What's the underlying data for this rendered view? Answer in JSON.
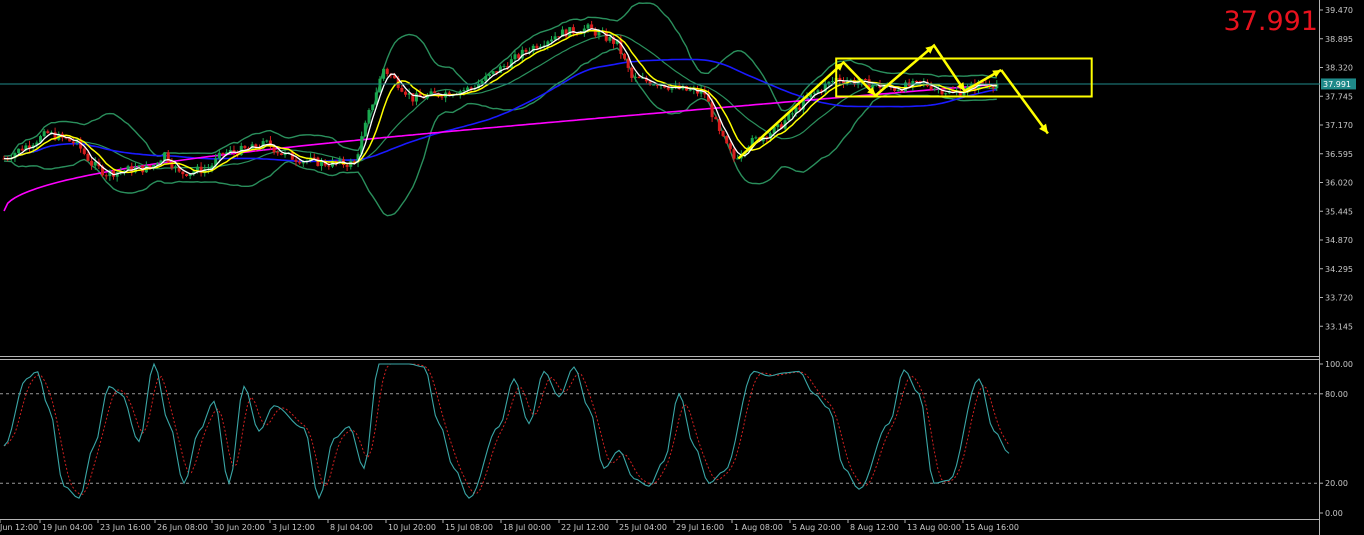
{
  "bid_display": "37.991",
  "current_price_label": "37.991",
  "chart_data": [
    {
      "type": "candlestick",
      "title": "",
      "price_axis_ticks": [
        "39.470",
        "38.895",
        "38.320",
        "37.745",
        "37.170",
        "36.595",
        "36.020",
        "35.445",
        "34.870",
        "34.295",
        "33.720",
        "33.145"
      ],
      "ylim": [
        32.8,
        39.6
      ],
      "time_axis_ticks": [
        "Jun 12:00",
        "19 Jun 04:00",
        "23 Jun 16:00",
        "26 Jun 08:00",
        "30 Jun 20:00",
        "3 Jul 12:00",
        "8 Jul 04:00",
        "10 Jul 20:00",
        "15 Jul 08:00",
        "18 Jul 00:00",
        "22 Jul 12:00",
        "25 Jul 04:00",
        "29 Jul 16:00",
        "1 Aug 08:00",
        "5 Aug 20:00",
        "8 Aug 12:00",
        "13 Aug 00:00",
        "15 Aug 16:00"
      ],
      "current_price": 37.991,
      "grid": false,
      "overlays": [
        {
          "name": "",
          "color": "#ffff00",
          "role": "fast moving average"
        },
        {
          "name": "",
          "color": "#ffffff",
          "role": "fastest moving average"
        },
        {
          "name": "",
          "color": "#2a8f5c",
          "role": "bollinger bands"
        },
        {
          "name": "",
          "color": "#1a1aff",
          "role": "slow moving average"
        },
        {
          "name": "",
          "color": "#ff00ff",
          "role": "slowest moving average"
        }
      ],
      "close_path": [
        [
          0,
          36.5
        ],
        [
          3,
          37.0
        ],
        [
          5,
          36.8
        ],
        [
          6,
          36.4
        ],
        [
          7,
          36.2
        ],
        [
          9,
          36.3
        ],
        [
          10,
          36.3
        ],
        [
          11,
          36.6
        ],
        [
          12,
          36.2
        ],
        [
          14,
          36.3
        ],
        [
          15,
          36.6
        ],
        [
          17,
          36.7
        ],
        [
          18,
          36.8
        ],
        [
          19,
          36.6
        ],
        [
          20,
          36.5
        ],
        [
          22,
          36.4
        ],
        [
          24,
          36.4
        ],
        [
          25,
          37.4
        ],
        [
          26,
          38.3
        ],
        [
          27,
          38.0
        ],
        [
          28,
          37.7
        ],
        [
          30,
          37.8
        ],
        [
          32,
          37.9
        ],
        [
          34,
          38.3
        ],
        [
          36,
          38.7
        ],
        [
          38,
          39.0
        ],
        [
          40,
          39.1
        ],
        [
          42,
          38.8
        ],
        [
          43,
          38.1
        ],
        [
          45,
          38.0
        ],
        [
          46,
          37.9
        ],
        [
          48,
          37.8
        ],
        [
          49,
          37.0
        ],
        [
          50,
          36.5
        ],
        [
          51,
          36.8
        ],
        [
          53,
          37.1
        ],
        [
          55,
          37.7
        ],
        [
          57,
          38.1
        ],
        [
          59,
          38.0
        ],
        [
          61,
          37.9
        ],
        [
          63,
          38.0
        ],
        [
          65,
          37.8
        ],
        [
          66,
          37.9
        ],
        [
          67,
          38.0
        ],
        [
          68,
          37.991
        ]
      ],
      "annotations": [
        {
          "type": "rectangle",
          "color": "#ffff00",
          "from": [
            57,
            37.74
          ],
          "to": [
            74.5,
            38.5
          ]
        },
        {
          "type": "zigzag-arrow",
          "color": "#ffff00",
          "points": [
            [
              50.3,
              36.5
            ],
            [
              57.5,
              38.42
            ],
            [
              59.7,
              37.76
            ],
            [
              63.7,
              38.76
            ],
            [
              65.8,
              37.85
            ],
            [
              68.3,
              38.27
            ]
          ]
        },
        {
          "type": "arrow",
          "color": "#ffff00",
          "from": [
            68.3,
            38.27
          ],
          "to": [
            71.5,
            37.0
          ]
        }
      ]
    },
    {
      "type": "line",
      "title": "",
      "ylim": [
        0,
        100
      ],
      "y_ticks": [
        "100.00",
        "80.00",
        "20.00",
        "0.00"
      ],
      "levels": [
        80,
        20
      ],
      "series": [
        {
          "name": "",
          "color": "#3aa6a6",
          "role": "main",
          "values": [
            [
              0,
              45
            ],
            [
              1.5,
              90
            ],
            [
              2.2,
              95
            ],
            [
              3,
              70
            ],
            [
              4,
              18
            ],
            [
              5,
              10
            ],
            [
              6,
              45
            ],
            [
              7,
              85
            ],
            [
              7.8,
              80
            ],
            [
              9,
              48
            ],
            [
              10,
              100
            ],
            [
              11,
              60
            ],
            [
              12,
              20
            ],
            [
              13,
              55
            ],
            [
              14,
              75
            ],
            [
              15,
              20
            ],
            [
              16,
              85
            ],
            [
              17,
              55
            ],
            [
              18,
              72
            ],
            [
              20,
              57
            ],
            [
              21,
              10
            ],
            [
              22,
              50
            ],
            [
              23,
              58
            ],
            [
              24,
              30
            ],
            [
              25,
              100
            ],
            [
              27,
              100
            ],
            [
              28,
              98
            ],
            [
              29,
              60
            ],
            [
              30,
              30
            ],
            [
              31,
              10
            ],
            [
              33,
              58
            ],
            [
              34,
              90
            ],
            [
              35,
              60
            ],
            [
              36,
              95
            ],
            [
              37,
              78
            ],
            [
              38,
              98
            ],
            [
              39,
              70
            ],
            [
              40,
              30
            ],
            [
              41,
              42
            ],
            [
              42,
              23
            ],
            [
              43,
              18
            ],
            [
              44,
              35
            ],
            [
              45,
              80
            ],
            [
              46,
              45
            ],
            [
              47,
              20
            ],
            [
              48,
              28
            ],
            [
              50,
              95
            ],
            [
              51,
              92
            ],
            [
              52,
              94
            ],
            [
              53,
              95
            ],
            [
              54,
              80
            ],
            [
              55,
              70
            ],
            [
              56,
              30
            ],
            [
              57,
              16
            ],
            [
              59,
              60
            ],
            [
              60,
              96
            ],
            [
              61,
              80
            ],
            [
              62,
              20
            ],
            [
              63,
              22
            ],
            [
              65,
              90
            ],
            [
              66,
              55
            ],
            [
              67,
              40
            ]
          ]
        },
        {
          "name": "",
          "color": "#d02020",
          "role": "signal",
          "dashed": true
        }
      ]
    }
  ]
}
